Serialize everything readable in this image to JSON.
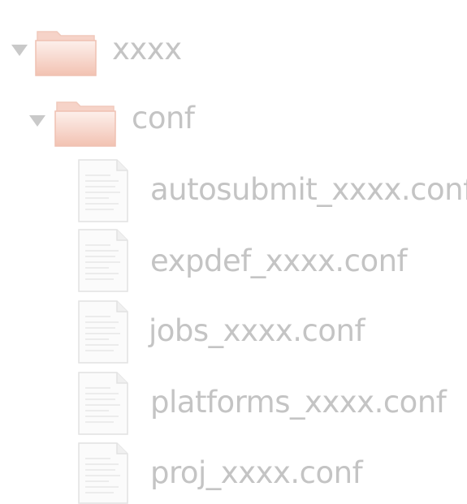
{
  "tree": {
    "root": {
      "label": "xxxx",
      "expanded": true,
      "icon": "folder-icon",
      "children": [
        {
          "label": "conf",
          "expanded": true,
          "icon": "folder-icon",
          "children": [
            {
              "label": "autosubmit_xxxx.conf",
              "icon": "text-file-icon"
            },
            {
              "label": "expdef_xxxx.conf",
              "icon": "text-file-icon"
            },
            {
              "label": "jobs_xxxx.conf",
              "icon": "text-file-icon"
            },
            {
              "label": "platforms_xxxx.conf",
              "icon": "text-file-icon"
            },
            {
              "label": "proj_xxxx.conf",
              "icon": "text-file-icon"
            }
          ]
        }
      ]
    }
  },
  "colors": {
    "text": "#c4c4c4",
    "expander": "#c9c9c9",
    "folder_light": "#fbe3dc",
    "folder_dark": "#f3bfae",
    "file_border": "#e2e2e2"
  }
}
